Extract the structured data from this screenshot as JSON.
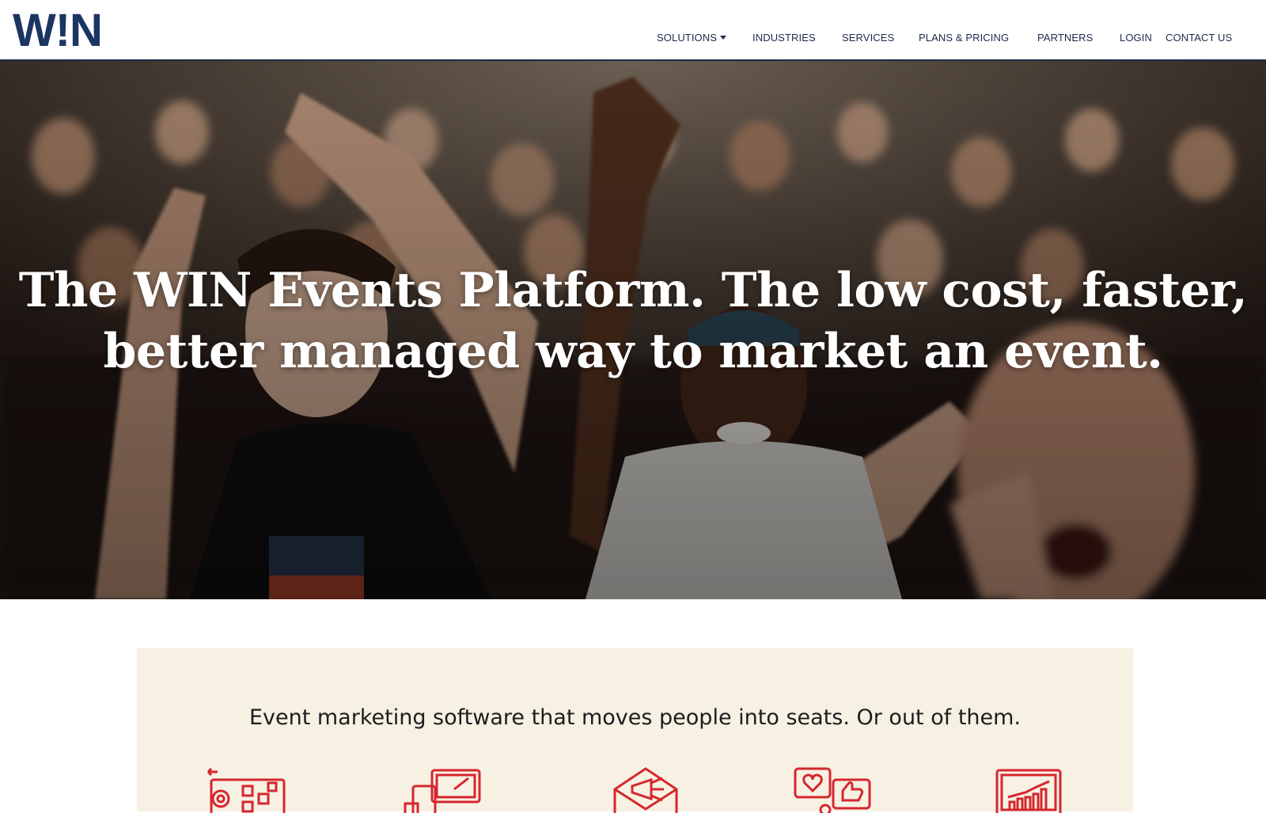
{
  "header": {
    "logo_text": "W!N",
    "nav": [
      {
        "label": "SOLUTIONS",
        "has_dropdown": true
      },
      {
        "label": "INDUSTRIES",
        "has_dropdown": false
      },
      {
        "label": "SERVICES",
        "has_dropdown": false
      },
      {
        "label": "PLANS & PRICING",
        "has_dropdown": false
      },
      {
        "label": "PARTNERS",
        "has_dropdown": false
      },
      {
        "label": "LOGIN",
        "has_dropdown": false
      },
      {
        "label": "CONTACT US",
        "has_dropdown": false
      }
    ]
  },
  "hero": {
    "headline_line1": "The WIN Events Platform. The low cost, faster,",
    "headline_line2": "better managed way to market an event."
  },
  "features": {
    "tagline": "Event marketing software that moves people into seats. Or out of them.",
    "icons": [
      "automation-gear-icon",
      "multi-device-icon",
      "email-megaphone-icon",
      "social-engagement-icon",
      "analytics-chart-icon"
    ]
  },
  "colors": {
    "brand_navy": "#1b3563",
    "accent_red": "#d7262e",
    "band_bg": "#f6f1e3",
    "header_border": "#1e2a48"
  }
}
